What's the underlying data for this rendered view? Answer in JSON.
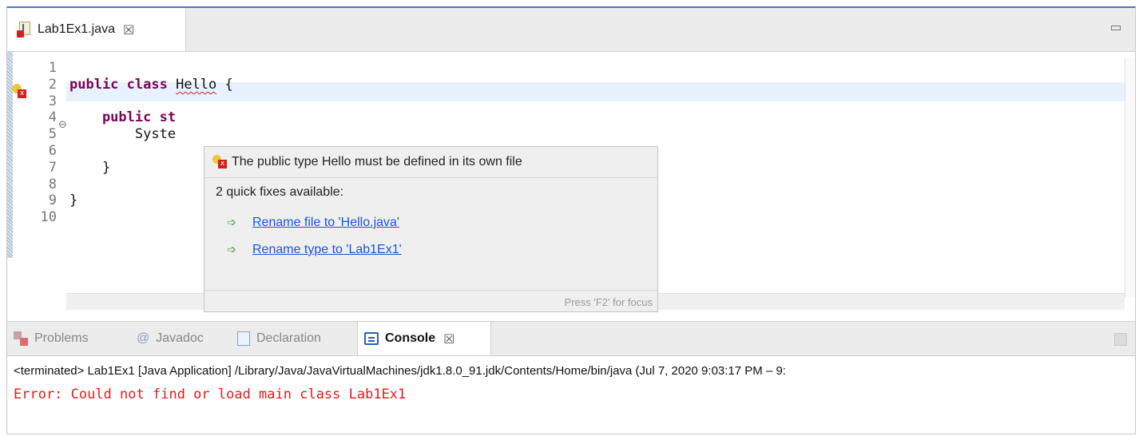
{
  "editor": {
    "tab_label": "Lab1Ex1.java",
    "tab_close": "☒",
    "line_numbers": "1\n2\n3\n4\n5\n6\n7\n8\n9\n10",
    "code": {
      "l1": "",
      "l2_kw": "public class",
      "l2_name": "Hello",
      "l2_rest": " {",
      "l3": "",
      "l4_kw": "    public st",
      "l5": "        Syste",
      "l6": "",
      "l7": "    }",
      "l8": "",
      "l9": "}",
      "l10": ""
    }
  },
  "popup": {
    "message": "The public type Hello must be defined in its own file",
    "subtitle": "2 quick fixes available:",
    "fixes": [
      "Rename file to 'Hello.java'",
      "Rename type to 'Lab1Ex1'"
    ],
    "hint": "Press 'F2' for focus"
  },
  "console_view": {
    "tabs": {
      "problems": "Problems",
      "javadoc": "Javadoc",
      "declaration": "Declaration",
      "console": "Console"
    },
    "tab_close": "☒",
    "terminated_line": "<terminated> Lab1Ex1 [Java Application] /Library/Java/JavaVirtualMachines/jdk1.8.0_91.jdk/Contents/Home/bin/java  (Jul 7, 2020 9:03:17 PM – 9:",
    "error_line": "Error: Could not find or load main class Lab1Ex1"
  },
  "colors": {
    "keyword": "#7f0055",
    "error_text": "#e01b1b",
    "link": "#1a55d8",
    "current_line": "#e8f2fe"
  }
}
